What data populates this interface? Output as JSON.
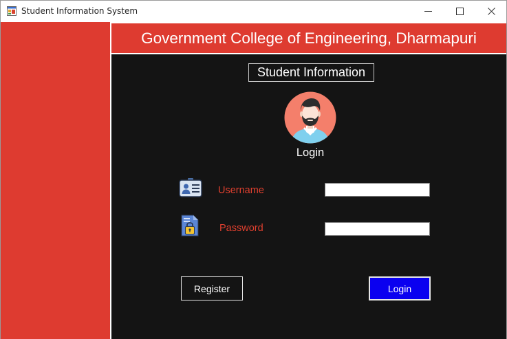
{
  "window": {
    "title": "Student Information System"
  },
  "header": {
    "title": "Government College of Engineering, Dharmapuri"
  },
  "main": {
    "section_title": "Student Information",
    "login_heading": "Login",
    "username": {
      "label": "Username",
      "icon": "id-card-icon",
      "value": ""
    },
    "password": {
      "label": "Password",
      "icon": "lock-document-icon",
      "value": ""
    },
    "buttons": {
      "register": "Register",
      "login": "Login"
    }
  },
  "colors": {
    "sidebar": "#de3b30",
    "header": "#de3b30",
    "panel": "#141414",
    "label": "#e0402f",
    "login_button": "#0a00f0"
  }
}
